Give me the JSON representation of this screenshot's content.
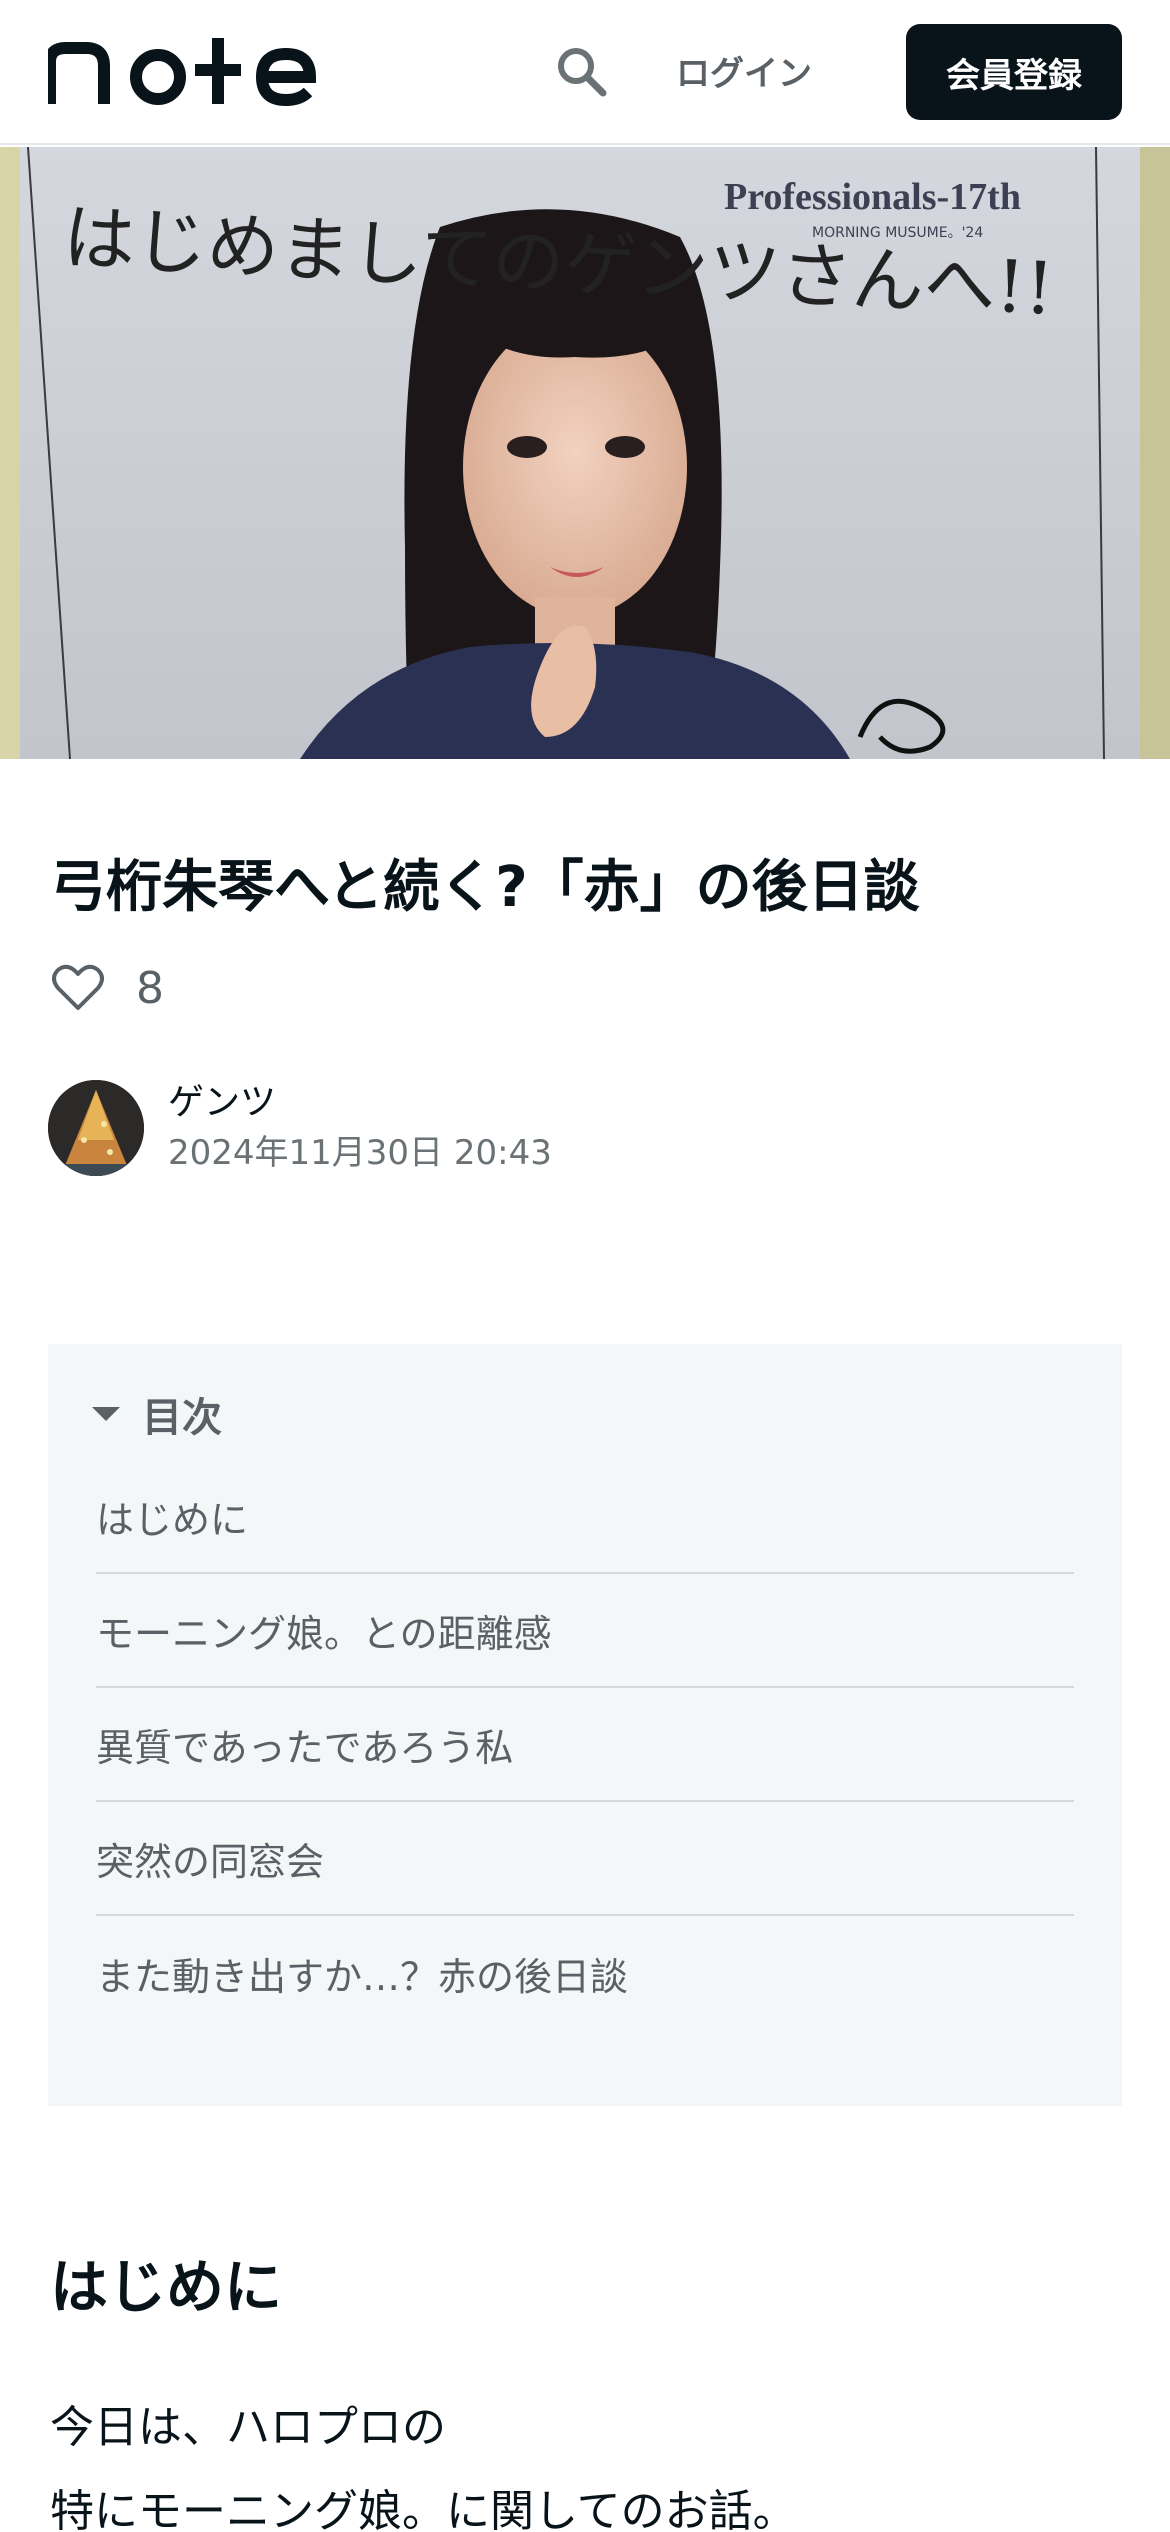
{
  "header": {
    "logo_text": "note",
    "search_icon": "search-icon",
    "login_label": "ログイン",
    "signup_label": "会員登録"
  },
  "hero": {
    "handwriting": "はじめましてのゲンツさんへ!!",
    "brand_text": "Professionals-17th",
    "brand_subtext": "MORNING MUSUME。'24"
  },
  "article": {
    "title": "弓桁朱琴へと続く?「赤」の後日談",
    "like_icon": "heart-icon",
    "like_count": "8",
    "author_name": "ゲンツ",
    "date": "2024年11月30日 20:43"
  },
  "toc": {
    "title": "目次",
    "items": [
      "はじめに",
      "モーニング娘。との距離感",
      "異質であったであろう私",
      "突然の同窓会",
      "また動き出すか…？赤の後日談"
    ]
  },
  "body": {
    "section_heading": "はじめに",
    "paragraph_lines": [
      "今日は、ハロプロの",
      "特にモーニング娘。に関してのお話。"
    ]
  },
  "colors": {
    "text": "#08131a",
    "muted": "#5a6166",
    "toc_bg": "#f4f7f8",
    "signup_bg": "#08131a"
  }
}
